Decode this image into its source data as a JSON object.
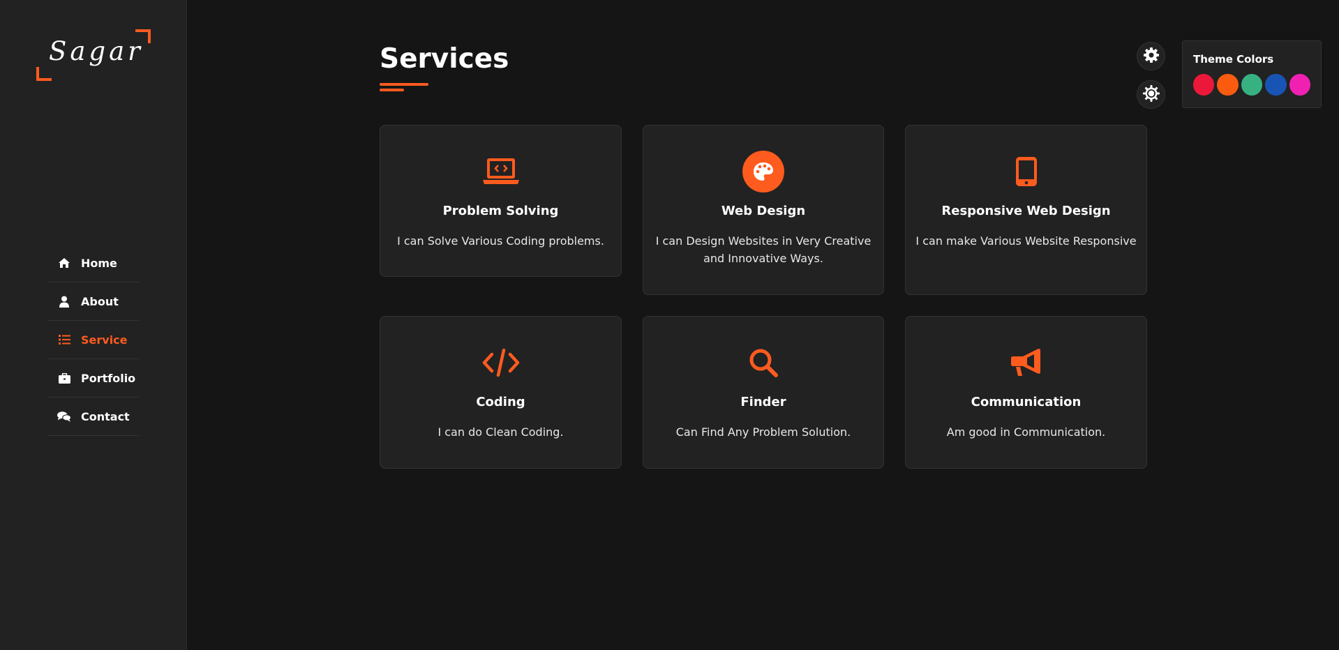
{
  "logo": {
    "text": "Sagar"
  },
  "nav": {
    "items": [
      {
        "label": "Home",
        "icon": "home-icon",
        "active": false
      },
      {
        "label": "About",
        "icon": "user-icon",
        "active": false
      },
      {
        "label": "Service",
        "icon": "list-icon",
        "active": true
      },
      {
        "label": "Portfolio",
        "icon": "briefcase-icon",
        "active": false
      },
      {
        "label": "Contact",
        "icon": "comments-icon",
        "active": false
      }
    ]
  },
  "main": {
    "title": "Services",
    "cards": [
      {
        "title": "Problem Solving",
        "description": "I can Solve Various Coding problems.",
        "icon": "laptop-code-icon"
      },
      {
        "title": "Web Design",
        "description": "I can Design Websites in Very Creative and Innovative Ways.",
        "icon": "palette-icon"
      },
      {
        "title": "Responsive Web Design",
        "description": "I can make Various Website Responsive",
        "icon": "mobile-icon"
      },
      {
        "title": "Coding",
        "description": "I can do Clean Coding.",
        "icon": "code-icon"
      },
      {
        "title": "Finder",
        "description": "Can Find Any Problem Solution.",
        "icon": "search-icon"
      },
      {
        "title": "Communication",
        "description": "Am good in Communication.",
        "icon": "bullhorn-icon"
      }
    ]
  },
  "theme_panel": {
    "title": "Theme Colors",
    "colors": [
      "#ec1839",
      "#fa5b0f",
      "#37b182",
      "#1854b4",
      "#f021b2"
    ]
  },
  "colors": {
    "accent": "#fe5b1f",
    "background": "#151515",
    "surface": "#222222"
  }
}
